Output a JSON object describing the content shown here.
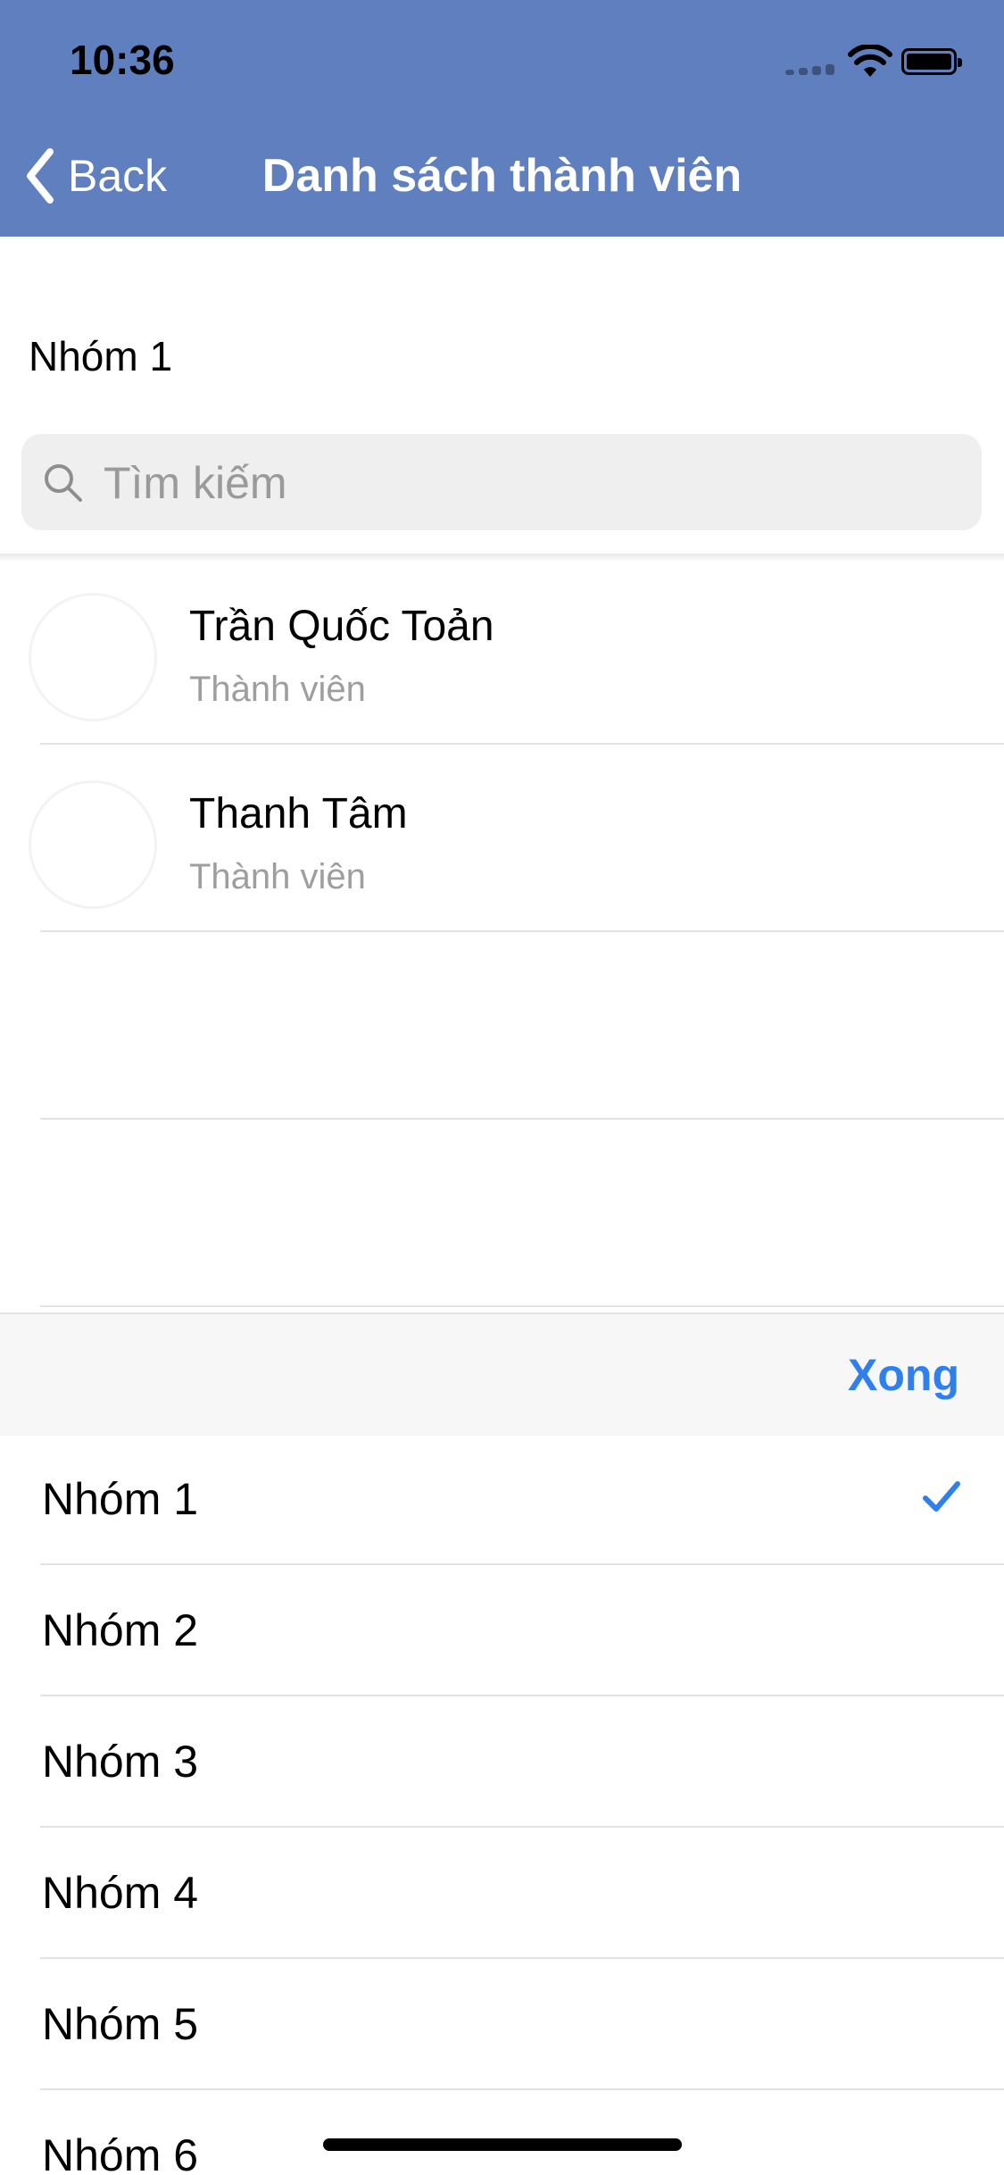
{
  "status_bar": {
    "time": "10:36"
  },
  "nav": {
    "back_label": "Back",
    "title": "Danh sách thành viên"
  },
  "group": {
    "label": "Nhóm 1"
  },
  "search": {
    "placeholder": "Tìm kiếm",
    "value": ""
  },
  "members": [
    {
      "name": "Trần Quốc Toản",
      "role": "Thành viên"
    },
    {
      "name": "Thanh Tâm",
      "role": "Thành viên"
    }
  ],
  "picker": {
    "done_label": "Xong",
    "selected": "Nhóm 1",
    "options": [
      "Nhóm 1",
      "Nhóm 2",
      "Nhóm 3",
      "Nhóm 4",
      "Nhóm 5",
      "Nhóm 6"
    ]
  },
  "colors": {
    "header": "#5f7fbf",
    "accent": "#2f80ee",
    "secondary_text": "#9e9e9e"
  }
}
